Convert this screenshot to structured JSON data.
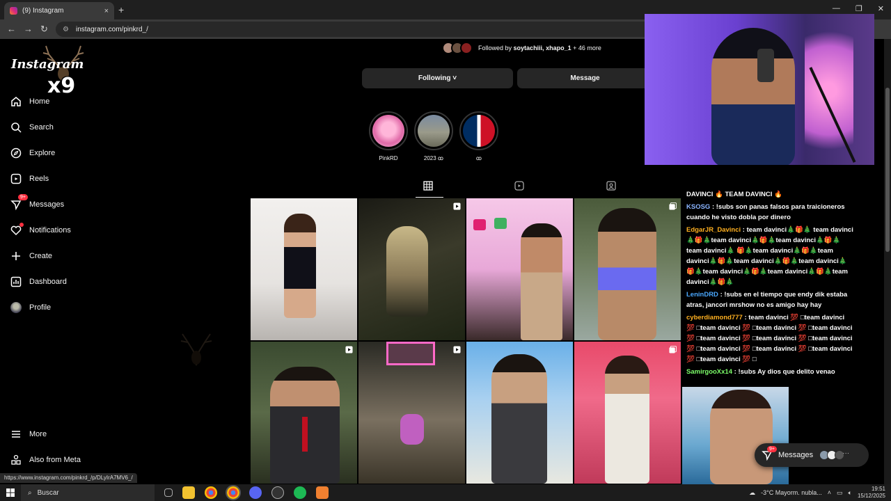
{
  "browser": {
    "tab_title": "(9) Instagram",
    "tab_close": "×",
    "new_tab": "+",
    "url": "instagram.com/pinkrd_/",
    "status_url": "https://www.instagram.com/pinkrd_/p/DLyIrA7MV6_/"
  },
  "sidebar": {
    "logo": "Instagram",
    "overlay_text": "x9",
    "items": [
      {
        "label": "Home",
        "icon": "home-icon"
      },
      {
        "label": "Search",
        "icon": "search-icon"
      },
      {
        "label": "Explore",
        "icon": "compass-icon"
      },
      {
        "label": "Reels",
        "icon": "reels-icon"
      },
      {
        "label": "Messages",
        "icon": "messenger-icon",
        "badge": "9+"
      },
      {
        "label": "Notifications",
        "icon": "heart-icon"
      },
      {
        "label": "Create",
        "icon": "plus-icon"
      },
      {
        "label": "Dashboard",
        "icon": "dashboard-icon"
      },
      {
        "label": "Profile",
        "icon": "avatar-icon"
      }
    ],
    "more": "More",
    "meta": "Also from Meta"
  },
  "profile": {
    "followed_prefix": "Followed by ",
    "followed_names": "soytachiii, xhapo_1",
    "followed_suffix": " + 46 more",
    "following_btn": "Following ˅",
    "message_btn": "Message",
    "highlights": [
      {
        "label": "PinkRD"
      },
      {
        "label": "2023 ꝏ"
      },
      {
        "label": "ꝏ"
      }
    ]
  },
  "chat": [
    {
      "user": "",
      "text": "DAVINCI 🔥 TEAM DAVINCI 🔥",
      "color": "#ffffff"
    },
    {
      "user": "KSOSG",
      "text": ": !subs son panas falsos para traicioneros cuando he visto dobla por dinero",
      "color": "#8ab4ff"
    },
    {
      "user": "EdgarJR_Davinci",
      "text": ": team davinci🎄🎁🎄 team davinci🎄🎁🎄team davinci🎄🎁🎄team davinci🎄🎁🎄team davinci🎄 🎁🎄team davinci🎄🎁🎄team davinci🎄🎁🎄team davinci🎄🎁🎄team davinci🎄🎁🎄team davinci🎄🎁🎄team davinci🎄🎁🎄team davinci🎄🎁🎄",
      "color": "#ffb020"
    },
    {
      "user": "LeninDRD",
      "text": ": !subs en el tiempo que endy dik estaba atras, jancori mrshow no es amigo hay hay",
      "color": "#4aa8ff"
    },
    {
      "user": "cyberdiamond777",
      "text": ": team davinci 💯 □team davinci 💯 □team davinci 💯 □team davinci 💯 □team davinci 💯 □team davinci 💯 □team davinci 💯 □team davinci 💯 □team davinci 💯 □team davinci 💯 □team davinci 💯 □team davinci 💯 □",
      "color": "#ffb020"
    },
    {
      "user": "SamirgooXx14",
      "text": ": !subs Ay dios que delito venao",
      "color": "#7dff6a"
    }
  ],
  "messages_bubble": {
    "label": "Messages",
    "badge": "9+"
  },
  "taskbar": {
    "search": "Buscar",
    "weather": "-3°C  Mayorm. nubla...",
    "time": "19:51",
    "date": "15/12/2025"
  }
}
